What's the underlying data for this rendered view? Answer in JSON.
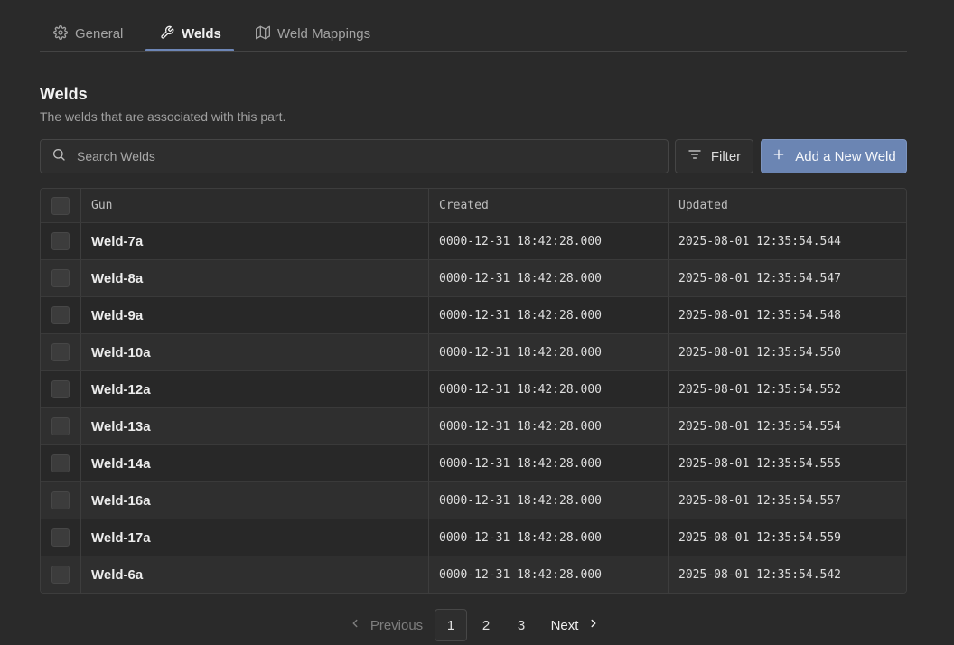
{
  "tabs": [
    {
      "label": "General",
      "icon": "gear-icon",
      "active": false
    },
    {
      "label": "Welds",
      "icon": "wrench-icon",
      "active": true
    },
    {
      "label": "Weld Mappings",
      "icon": "map-icon",
      "active": false
    }
  ],
  "section": {
    "title": "Welds",
    "subtitle": "The welds that are associated with this part."
  },
  "toolbar": {
    "search_placeholder": "Search Welds",
    "filter_label": "Filter",
    "add_label": "Add a New Weld"
  },
  "table": {
    "columns": [
      "Gun",
      "Created",
      "Updated"
    ],
    "rows": [
      {
        "gun": "Weld-7a",
        "created": "0000-12-31 18:42:28.000",
        "updated": "2025-08-01 12:35:54.544"
      },
      {
        "gun": "Weld-8a",
        "created": "0000-12-31 18:42:28.000",
        "updated": "2025-08-01 12:35:54.547"
      },
      {
        "gun": "Weld-9a",
        "created": "0000-12-31 18:42:28.000",
        "updated": "2025-08-01 12:35:54.548"
      },
      {
        "gun": "Weld-10a",
        "created": "0000-12-31 18:42:28.000",
        "updated": "2025-08-01 12:35:54.550"
      },
      {
        "gun": "Weld-12a",
        "created": "0000-12-31 18:42:28.000",
        "updated": "2025-08-01 12:35:54.552"
      },
      {
        "gun": "Weld-13a",
        "created": "0000-12-31 18:42:28.000",
        "updated": "2025-08-01 12:35:54.554"
      },
      {
        "gun": "Weld-14a",
        "created": "0000-12-31 18:42:28.000",
        "updated": "2025-08-01 12:35:54.555"
      },
      {
        "gun": "Weld-16a",
        "created": "0000-12-31 18:42:28.000",
        "updated": "2025-08-01 12:35:54.557"
      },
      {
        "gun": "Weld-17a",
        "created": "0000-12-31 18:42:28.000",
        "updated": "2025-08-01 12:35:54.559"
      },
      {
        "gun": "Weld-6a",
        "created": "0000-12-31 18:42:28.000",
        "updated": "2025-08-01 12:35:54.542"
      }
    ]
  },
  "pagination": {
    "previous_label": "Previous",
    "next_label": "Next",
    "pages": [
      "1",
      "2",
      "3"
    ],
    "current_page": "1"
  },
  "colors": {
    "background": "#2a2a2a",
    "accent": "#6b85b3",
    "tab_underline": "#6d86b6"
  }
}
